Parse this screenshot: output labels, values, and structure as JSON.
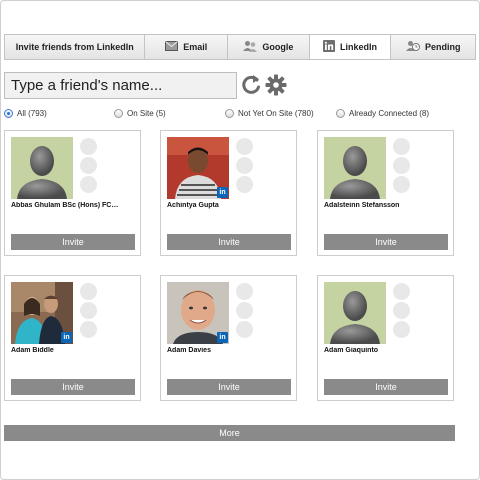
{
  "tabs": {
    "title": "Invite friends from LinkedIn",
    "email": "Email",
    "google": "Google",
    "linkedin": "LinkedIn",
    "pending": "Pending"
  },
  "search": {
    "placeholder": "Type a friend's name...",
    "value": ""
  },
  "filters": [
    {
      "label": "All (793)",
      "selected": true
    },
    {
      "label": "On Site (5)",
      "selected": false
    },
    {
      "label": "Not Yet On Site (780)",
      "selected": false
    },
    {
      "label": "Already Connected (8)",
      "selected": false
    }
  ],
  "contacts": [
    {
      "name": "Abbas Ghulam BSc (Hons) FC…",
      "photo": "placeholder",
      "linkedin_badge": false
    },
    {
      "name": "Achintya Gupta",
      "photo": "person",
      "linkedin_badge": true
    },
    {
      "name": "Adalsteinn Stefansson",
      "photo": "placeholder",
      "linkedin_badge": false
    },
    {
      "name": "Adam Biddle",
      "photo": "couple",
      "linkedin_badge": true
    },
    {
      "name": "Adam Davies",
      "photo": "person",
      "linkedin_badge": true
    },
    {
      "name": "Adam Giaquinto",
      "photo": "placeholder",
      "linkedin_badge": false
    }
  ],
  "invite_label": "Invite",
  "more_label": "More",
  "badge_text": "in",
  "icons": {
    "email": "envelope-icon",
    "google": "people-icon",
    "linkedin": "linkedin-icon",
    "pending": "pending-people-icon",
    "refresh": "refresh-icon",
    "settings": "gear-icon"
  },
  "colors": {
    "button": "#8a8a8a",
    "linkedin": "#0b66b7",
    "radio_selected": "#2a6fd6"
  }
}
